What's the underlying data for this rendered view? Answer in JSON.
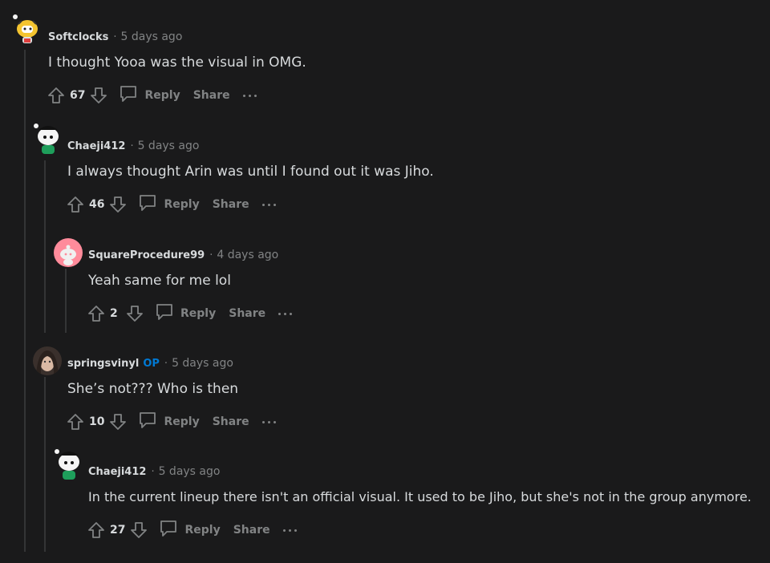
{
  "comments": [
    {
      "author": "Softclocks",
      "op": "",
      "time": "5 days ago",
      "text": "I thought Yooa was the visual in OMG.",
      "score": "67",
      "reply": "Reply",
      "share": "Share",
      "avatar": "snoo-tiger-avatar"
    },
    {
      "author": "Chaeji412",
      "op": "",
      "time": "5 days ago",
      "text": "I always thought Arin was until I found out it was Jiho.",
      "score": "46",
      "reply": "Reply",
      "share": "Share",
      "avatar": "snoo-green-avatar"
    },
    {
      "author": "SquareProcedure99",
      "op": "",
      "time": "4 days ago",
      "text": "Yeah same for me lol",
      "score": "2",
      "reply": "Reply",
      "share": "Share",
      "avatar": "snoo-pink-avatar"
    },
    {
      "author": "springsvinyl",
      "op": "OP",
      "time": "5 days ago",
      "text": "She’s not??? Who is then",
      "score": "10",
      "reply": "Reply",
      "share": "Share",
      "avatar": "photo-avatar"
    },
    {
      "author": "Chaeji412",
      "op": "",
      "time": "5 days ago",
      "text": "In the current lineup there isn't an official visual. It used to be Jiho, but she's not in the group anymore.",
      "score": "27",
      "reply": "Reply",
      "share": "Share",
      "avatar": "snoo-green-avatar"
    }
  ],
  "separator": "·"
}
